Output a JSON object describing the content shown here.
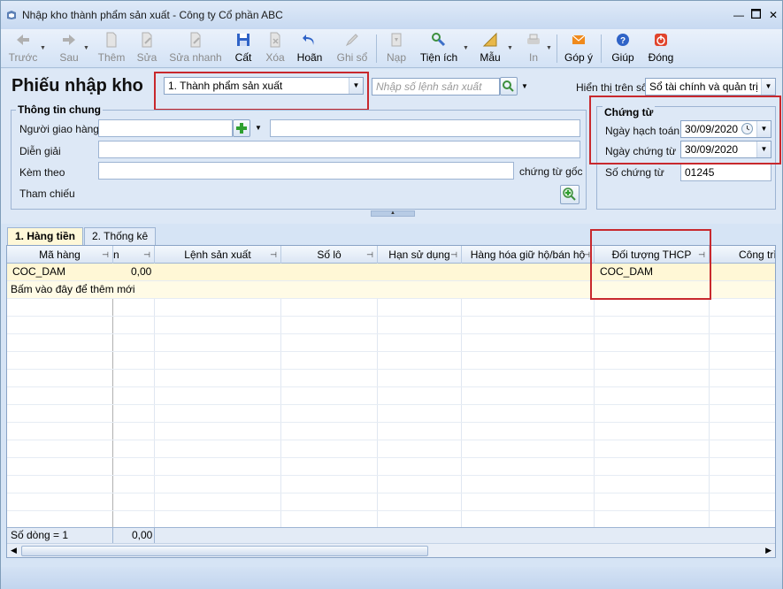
{
  "window": {
    "title": "Nhập kho thành phẩm sản xuất - Công ty Cổ phần ABC"
  },
  "toolbar": {
    "prev": "Trước",
    "next": "Sau",
    "add": "Thêm",
    "edit": "Sửa",
    "quick_edit": "Sửa nhanh",
    "save": "Cất",
    "delete": "Xóa",
    "undo": "Hoãn",
    "post": "Ghi sổ",
    "load": "Nạp",
    "utilities": "Tiện ích",
    "template": "Mẫu",
    "print": "In",
    "feedback": "Góp ý",
    "help": "Giúp",
    "close": "Đóng"
  },
  "header": {
    "title": "Phiếu nhập kho",
    "type_value": "1. Thành phẩm sản xuất",
    "production_order_placeholder": "Nhập số lệnh sản xuất",
    "display_label": "Hiển thị trên sổ",
    "display_value": "Sổ tài chính và quản trị"
  },
  "general": {
    "group_title": "Thông tin chung",
    "deliverer_label": "Người giao hàng",
    "desc_label": "Diễn giải",
    "attach_label": "Kèm theo",
    "orig_doc_label": "chứng từ gốc",
    "reference_label": "Tham chiếu"
  },
  "voucher": {
    "group_title": "Chứng từ",
    "accounting_date_label": "Ngày hạch toán",
    "accounting_date": "30/09/2020",
    "voucher_date_label": "Ngày chứng từ",
    "voucher_date": "30/09/2020",
    "voucher_no_label": "Số chứng từ",
    "voucher_no": "01245"
  },
  "tabs": [
    {
      "label": "1. Hàng tiền"
    },
    {
      "label": "2. Thống kê"
    }
  ],
  "grid": {
    "columns": [
      "Mã hàng",
      "n",
      "Lệnh sản xuất",
      "Số lô",
      "Hạn sử dụng",
      "Hàng hóa giữ hộ/bán hộ",
      "Đối tượng THCP",
      "Công trì"
    ],
    "rows": [
      {
        "item_code": "COC_DAM",
        "amount": "0,00",
        "cost_object": "COC_DAM"
      }
    ],
    "new_row_hint": "Bấm vào đây để thêm mới",
    "footer_count": "Số dòng = 1",
    "footer_total": "0,00"
  }
}
